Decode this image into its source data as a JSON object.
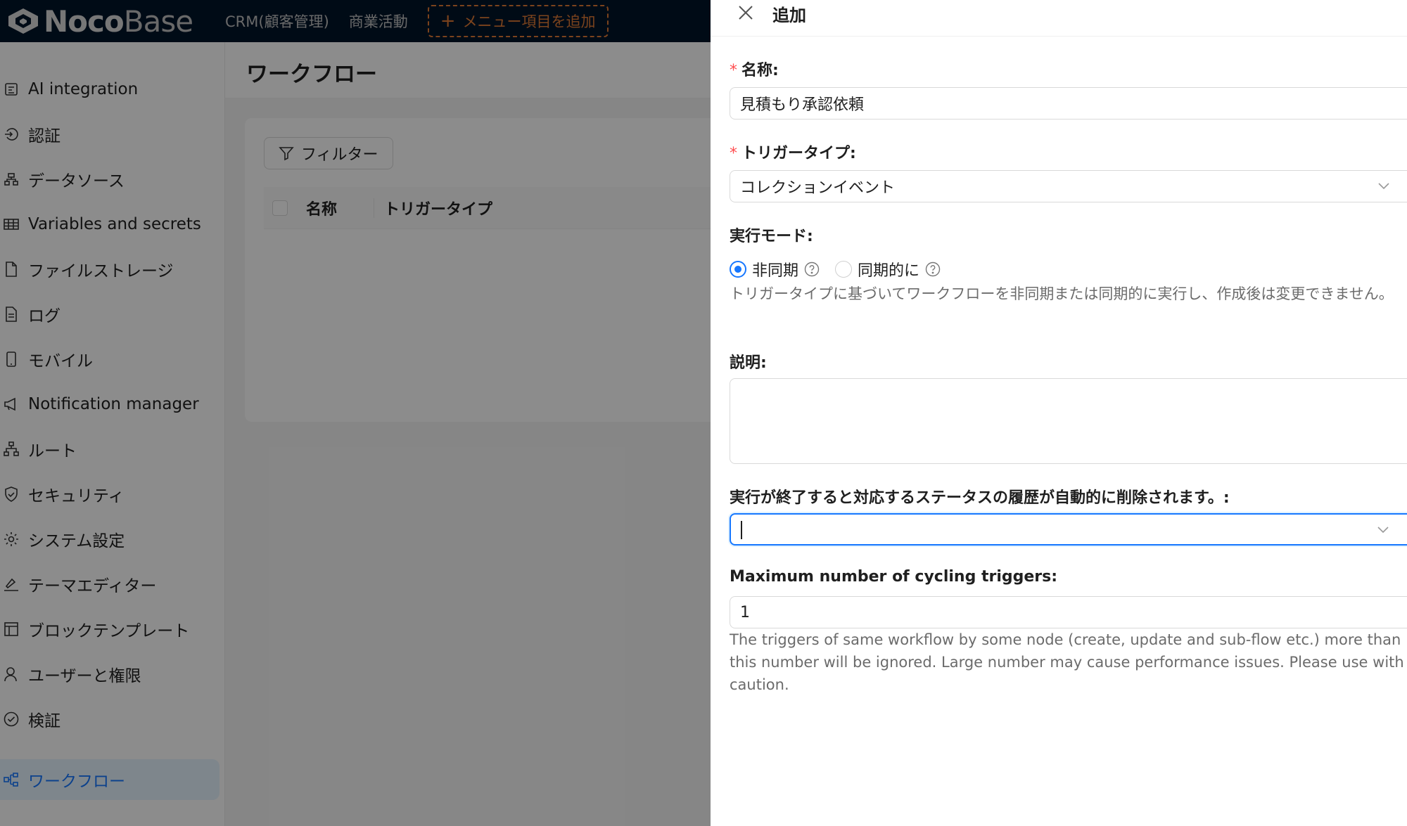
{
  "topbar": {
    "logo_bold": "Noco",
    "logo_light": "Base",
    "nav": [
      "CRM(顧客管理)",
      "商業活動"
    ],
    "add_menu_label": "メニュー項目を追加"
  },
  "sidebar": {
    "items": [
      {
        "label": "AI integration",
        "icon": "ai-icon"
      },
      {
        "label": "認証",
        "icon": "login-icon"
      },
      {
        "label": "データソース",
        "icon": "database-icon"
      },
      {
        "label": "Variables and secrets",
        "icon": "table-icon"
      },
      {
        "label": "ファイルストレージ",
        "icon": "file-icon"
      },
      {
        "label": "ログ",
        "icon": "log-icon"
      },
      {
        "label": "モバイル",
        "icon": "mobile-icon"
      },
      {
        "label": "Notification manager",
        "icon": "megaphone-icon"
      },
      {
        "label": "ルート",
        "icon": "route-icon"
      },
      {
        "label": "セキュリティ",
        "icon": "shield-icon"
      },
      {
        "label": "システム設定",
        "icon": "gear-icon"
      },
      {
        "label": "テーマエディター",
        "icon": "brush-icon"
      },
      {
        "label": "ブロックテンプレート",
        "icon": "template-icon"
      },
      {
        "label": "ユーザーと権限",
        "icon": "user-icon"
      },
      {
        "label": "検証",
        "icon": "check-circle-icon"
      },
      {
        "label": "ワークフロー",
        "icon": "workflow-icon",
        "active": true
      }
    ]
  },
  "main": {
    "title": "ワークフロー",
    "filter_label": "フィルター",
    "columns": [
      "名称",
      "トリガータイプ"
    ]
  },
  "drawer": {
    "title": "追加",
    "name_label": "名称",
    "name_value": "見積もり承認依頼",
    "trigger_label": "トリガータイプ",
    "trigger_value": "コレクションイベント",
    "mode_label": "実行モード",
    "mode_options": [
      "非同期",
      "同期的に"
    ],
    "mode_selected": "非同期",
    "mode_help": "トリガータイプに基づいてワークフローを非同期または同期的に実行し、作成後は変更できません。",
    "description_label": "説明",
    "history_label": "実行が終了すると対応するステータスの履歴が自動的に削除されます。",
    "max_label": "Maximum number of cycling triggers",
    "max_value": "1",
    "max_help": "The triggers of same workflow by some node (create, update and sub-flow etc.) more than this number will be ignored. Large number may cause performance issues. Please use with caution."
  },
  "colors": {
    "header_bg": "#001529",
    "accent": "#1677ff",
    "add_menu": "#e07a35",
    "required": "#ff4d4f"
  }
}
